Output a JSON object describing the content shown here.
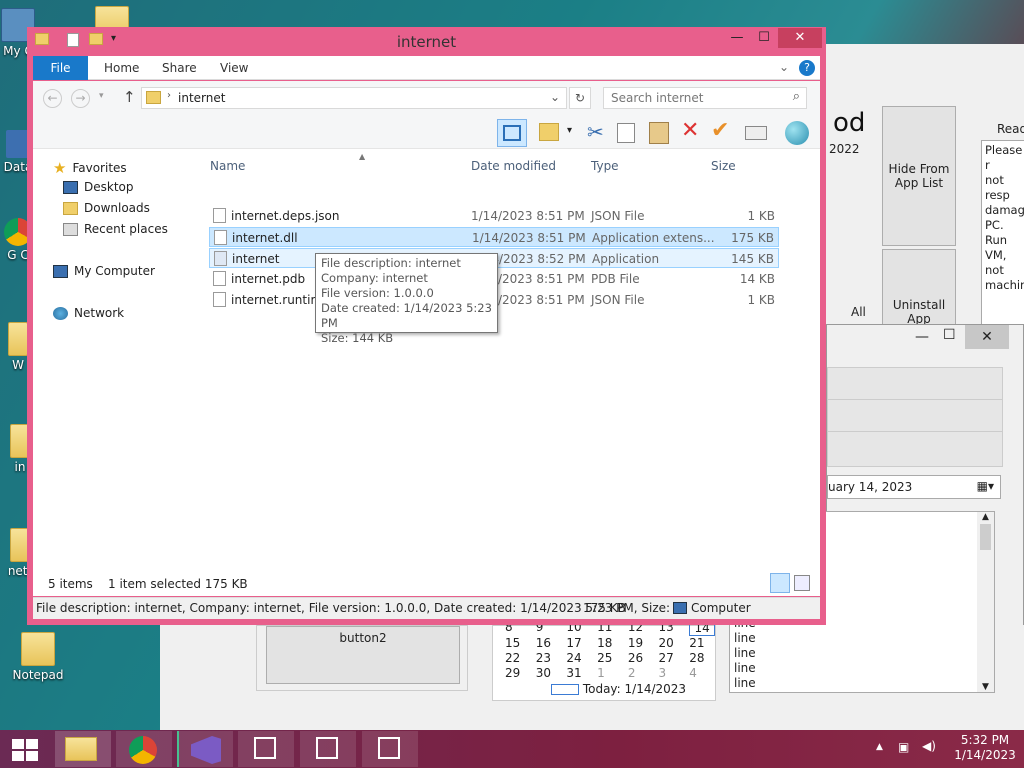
{
  "desktop": {
    "icons": [
      {
        "label": "My C"
      },
      {
        "label": "Data"
      },
      {
        "label": "G C"
      },
      {
        "label": "W"
      },
      {
        "label": "in"
      },
      {
        "label": "net("
      },
      {
        "label": "Notepad"
      }
    ]
  },
  "bg_app": {
    "title_partial": "od",
    "year_partial": "2022",
    "hide_btn": "Hide From App List",
    "uninstall_btn": "Uninstall App",
    "all_label": "All",
    "read_label": "Read",
    "read_text": [
      "Please r",
      "not resp",
      "damage",
      "PC. Run",
      "VM, not",
      "machin"
    ],
    "date_value": "uary   14, 2023",
    "button2": "button2",
    "calendar_rows": [
      [
        "8",
        "9",
        "10",
        "11",
        "12",
        "13",
        "14"
      ],
      [
        "15",
        "16",
        "17",
        "18",
        "19",
        "20",
        "21"
      ],
      [
        "22",
        "23",
        "24",
        "25",
        "26",
        "27",
        "28"
      ],
      [
        "29",
        "30",
        "31",
        "1",
        "2",
        "3",
        "4"
      ]
    ],
    "today_label": "Today: 1/14/2023",
    "lines": [
      "line",
      "line",
      "line",
      "line",
      "line"
    ]
  },
  "explorer": {
    "title": "internet",
    "tabs": {
      "file": "File",
      "home": "Home",
      "share": "Share",
      "view": "View"
    },
    "address": "internet",
    "search_placeholder": "Search internet",
    "nav": {
      "favorites": "Favorites",
      "desktop": "Desktop",
      "downloads": "Downloads",
      "recent": "Recent places",
      "computer": "My Computer",
      "network": "Network"
    },
    "columns": {
      "name": "Name",
      "date": "Date modified",
      "type": "Type",
      "size": "Size"
    },
    "files": [
      {
        "name": "internet.deps.json",
        "date": "1/14/2023 8:51 PM",
        "type": "JSON File",
        "size": "1 KB"
      },
      {
        "name": "internet.dll",
        "date": "1/14/2023 8:51 PM",
        "type": "Application extens...",
        "size": "175 KB"
      },
      {
        "name": "internet",
        "date": "1/14/2023 8:52 PM",
        "type": "Application",
        "size": "145 KB"
      },
      {
        "name": "internet.pdb",
        "date": "1/14/2023 8:51 PM",
        "type": "PDB File",
        "size": "14 KB"
      },
      {
        "name": "internet.runtime",
        "date": "1/14/2023 8:51 PM",
        "type": "JSON File",
        "size": "1 KB"
      }
    ],
    "tooltip": {
      "l1": "File description: internet",
      "l2": "Company: internet",
      "l3": "File version: 1.0.0.0",
      "l4": "Date created: 1/14/2023 5:23 PM",
      "l5": "Size: 144 KB"
    },
    "status": {
      "items": "5 items",
      "selected": "1 item selected  175 KB"
    },
    "details": {
      "text": "File description: internet, Company: internet, File version: 1.0.0.0, Date created: 1/14/2023 5:23 PM, Size:",
      "size": "175 KB",
      "location": "Computer"
    }
  },
  "taskbar": {
    "time": "5:32 PM",
    "date": "1/14/2023"
  },
  "colors": {
    "window_border": "#e85f8c",
    "file_tab": "#1979ca",
    "selection": "#cce8ff"
  }
}
